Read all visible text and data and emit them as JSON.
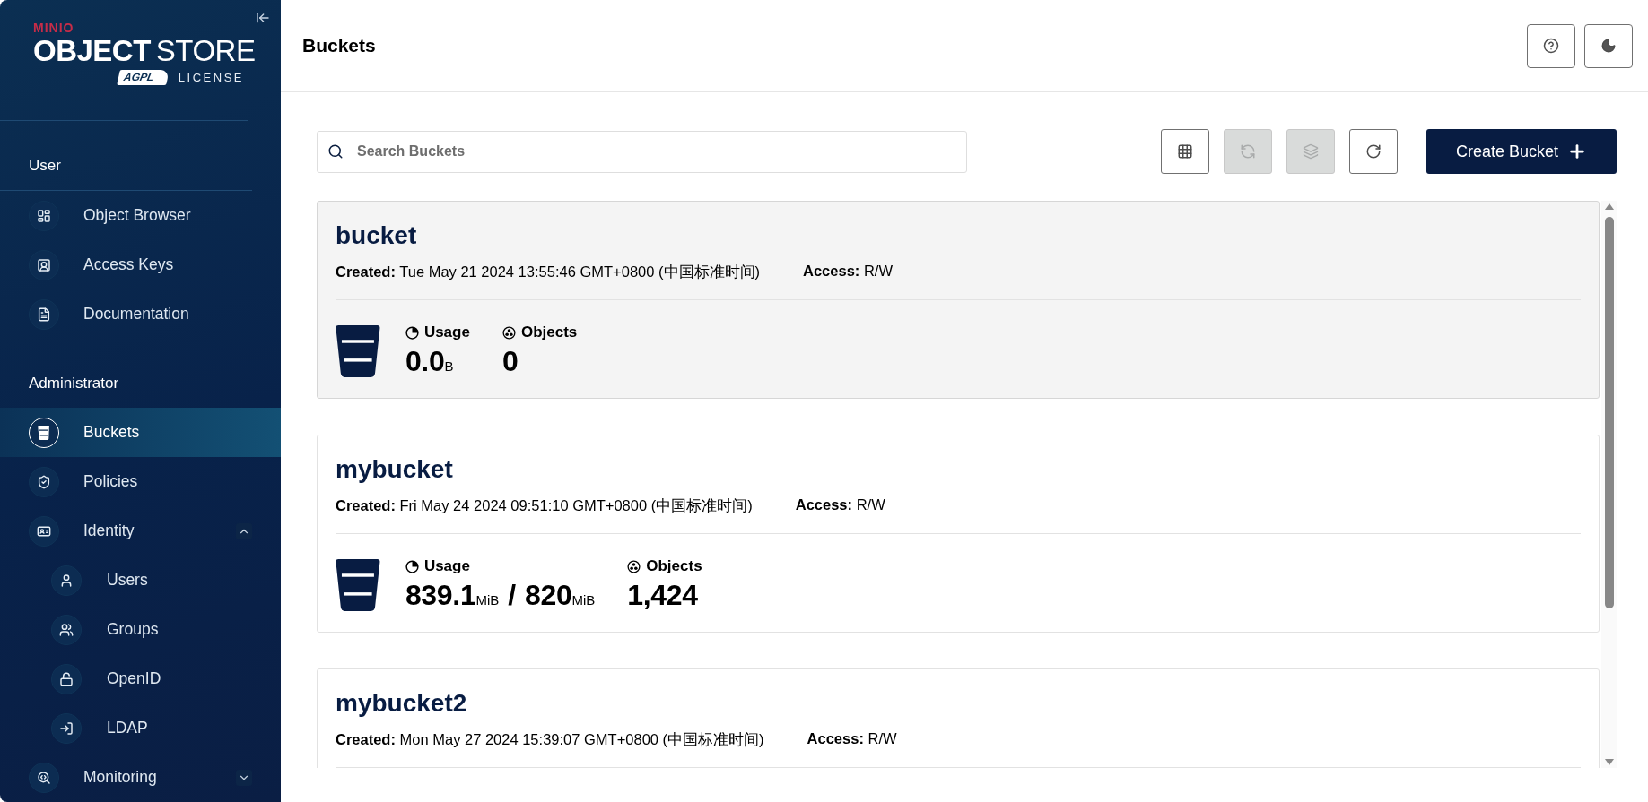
{
  "logo": {
    "brand": "MINIO",
    "product_bold": "OBJECT",
    "product_light": "STORE",
    "badge": "AGPL",
    "license": "LICENSE"
  },
  "sidebar": {
    "sections": [
      {
        "title": "User",
        "items": [
          {
            "label": "Object Browser",
            "selected": false
          },
          {
            "label": "Access Keys",
            "selected": false
          },
          {
            "label": "Documentation",
            "selected": false
          }
        ]
      },
      {
        "title": "Administrator",
        "items": [
          {
            "label": "Buckets",
            "selected": true
          },
          {
            "label": "Policies",
            "selected": false
          },
          {
            "label": "Identity",
            "selected": false,
            "expanded": true,
            "children": [
              {
                "label": "Users",
                "selected": false
              },
              {
                "label": "Groups",
                "selected": false
              },
              {
                "label": "OpenID",
                "selected": false
              },
              {
                "label": "LDAP",
                "selected": false
              }
            ]
          },
          {
            "label": "Monitoring",
            "selected": false,
            "expanded": false
          }
        ]
      }
    ]
  },
  "header": {
    "title": "Buckets"
  },
  "search": {
    "placeholder": "Search Buckets"
  },
  "toolbar": [
    {
      "kind": "grid",
      "disabled": false
    },
    {
      "kind": "sync",
      "disabled": true
    },
    {
      "kind": "multi",
      "disabled": true
    },
    {
      "kind": "refresh",
      "disabled": false
    }
  ],
  "create_button": {
    "label": "Create Bucket"
  },
  "buckets": [
    {
      "name": "bucket",
      "hovered": true,
      "created_label": "Created:",
      "created": "Tue May 21 2024 13:55:46 GMT+0800 (中国标准时间)",
      "access_label": "Access:",
      "access": "R/W",
      "usage_label": "Usage",
      "usage": [
        {
          "kind": "value",
          "text": "0.0"
        },
        {
          "kind": "unit",
          "text": "B"
        }
      ],
      "objects_label": "Objects",
      "objects": "0"
    },
    {
      "name": "mybucket",
      "hovered": false,
      "created_label": "Created:",
      "created": "Fri May 24 2024 09:51:10 GMT+0800 (中国标准时间)",
      "access_label": "Access:",
      "access": "R/W",
      "usage_label": "Usage",
      "usage": [
        {
          "kind": "value",
          "text": "839.1"
        },
        {
          "kind": "unit",
          "text": "MiB"
        },
        {
          "kind": "separator",
          "text": "/"
        },
        {
          "kind": "value",
          "text": "820"
        },
        {
          "kind": "unit",
          "text": "MiB"
        }
      ],
      "objects_label": "Objects",
      "objects": "1,424"
    },
    {
      "name": "mybucket2",
      "hovered": false,
      "created_label": "Created:",
      "created": "Mon May 27 2024 15:39:07 GMT+0800 (中国标准时间)",
      "access_label": "Access:",
      "access": "R/W"
    }
  ]
}
